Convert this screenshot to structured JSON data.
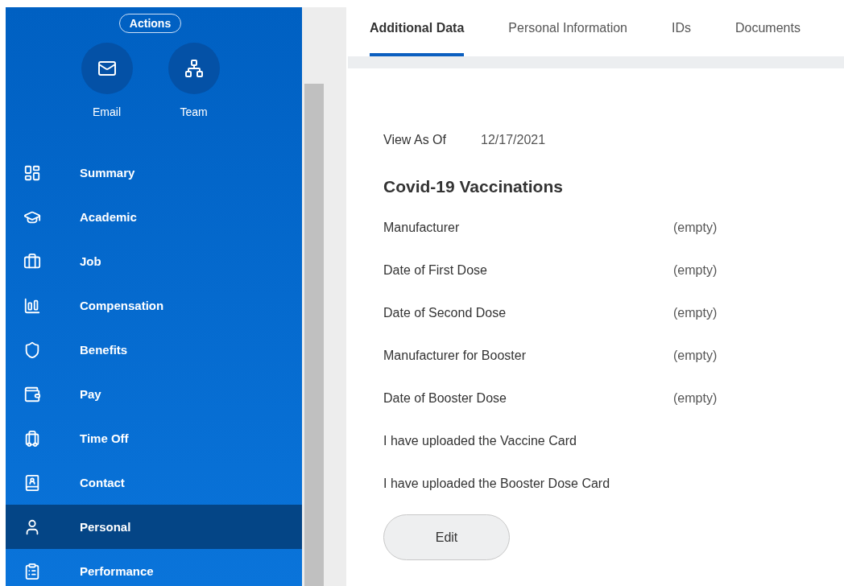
{
  "sidebar": {
    "actions_button": "Actions",
    "quick_actions": [
      {
        "label": "Email"
      },
      {
        "label": "Team"
      }
    ],
    "items": [
      {
        "label": "Summary",
        "selected": false
      },
      {
        "label": "Academic",
        "selected": false
      },
      {
        "label": "Job",
        "selected": false
      },
      {
        "label": "Compensation",
        "selected": false
      },
      {
        "label": "Benefits",
        "selected": false
      },
      {
        "label": "Pay",
        "selected": false
      },
      {
        "label": "Time Off",
        "selected": false
      },
      {
        "label": "Contact",
        "selected": false
      },
      {
        "label": "Personal",
        "selected": true
      },
      {
        "label": "Performance",
        "selected": false
      }
    ]
  },
  "tabs": [
    {
      "label": "Additional Data",
      "selected": true
    },
    {
      "label": "Personal Information",
      "selected": false
    },
    {
      "label": "IDs",
      "selected": false
    },
    {
      "label": "Documents",
      "selected": false
    }
  ],
  "view_as_of": {
    "label": "View As Of",
    "value": "12/17/2021"
  },
  "section_title": "Covid-19 Vaccinations",
  "fields": [
    {
      "label": "Manufacturer",
      "value": "(empty)"
    },
    {
      "label": "Date of First Dose",
      "value": "(empty)"
    },
    {
      "label": "Date of Second Dose",
      "value": "(empty)"
    },
    {
      "label": "Manufacturer for Booster",
      "value": "(empty)"
    },
    {
      "label": "Date of Booster Dose",
      "value": "(empty)"
    },
    {
      "label": "I have uploaded the Vaccine Card"
    },
    {
      "label": "I have uploaded the Booster Dose Card"
    }
  ],
  "edit_button": "Edit"
}
